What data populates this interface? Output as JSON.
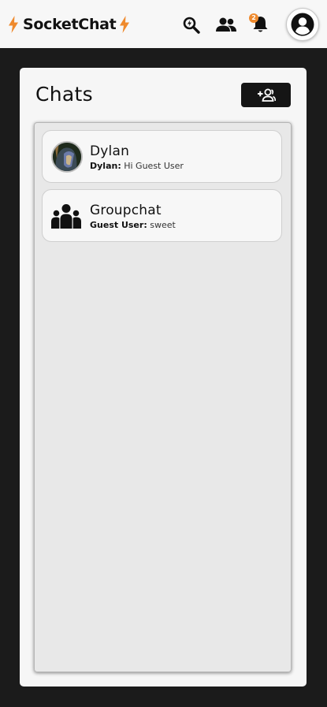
{
  "app": {
    "brand": "SocketChat",
    "accent_color": "#ef8a2d",
    "notification_count": "2"
  },
  "header": {
    "icons": [
      "search-flash-icon",
      "friends-icon",
      "bell-icon",
      "profile-icon"
    ]
  },
  "panel": {
    "title": "Chats",
    "add_button_icon": "add-group-icon"
  },
  "chats": [
    {
      "name": "Dylan",
      "sender": "Dylan:",
      "message": "Hi Guest User",
      "icon": "avatar-photo"
    },
    {
      "name": "Groupchat",
      "sender": "Guest User:",
      "message": "sweet",
      "icon": "group-icon"
    }
  ]
}
